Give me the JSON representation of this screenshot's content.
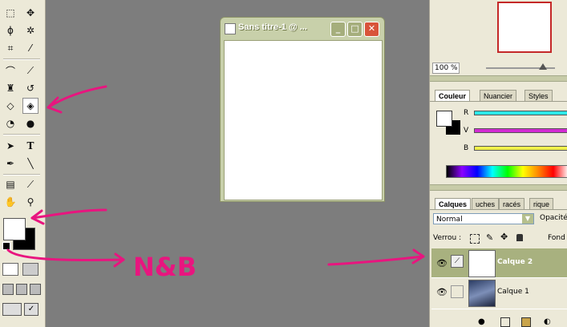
{
  "document": {
    "title": "Sans titre-1 @ ...",
    "buttons": {
      "minimize": "_",
      "maximize": "□",
      "close": "✕"
    }
  },
  "navigator": {
    "zoom": "100 %"
  },
  "color_panel": {
    "tabs": [
      "Couleur",
      "Nuancier",
      "Styles"
    ],
    "sliders": [
      {
        "label": "R",
        "color": "#2ee8e8"
      },
      {
        "label": "V",
        "color": "#d22bd2"
      },
      {
        "label": "B",
        "color": "#f0f04a"
      }
    ]
  },
  "layers_panel": {
    "tabs": [
      "Calques",
      "uches",
      "racés",
      "rique"
    ],
    "blend_mode": "Normal",
    "opacity_label": "Opacité",
    "lock_label": "Verrou :",
    "fill_label": "Fond",
    "layers": [
      {
        "name": "Calque 2",
        "selected": true
      },
      {
        "name": "Calque 1",
        "selected": false
      }
    ]
  },
  "annotations": {
    "nb_text": "N&B",
    "arrow_color": "#e8157f"
  }
}
